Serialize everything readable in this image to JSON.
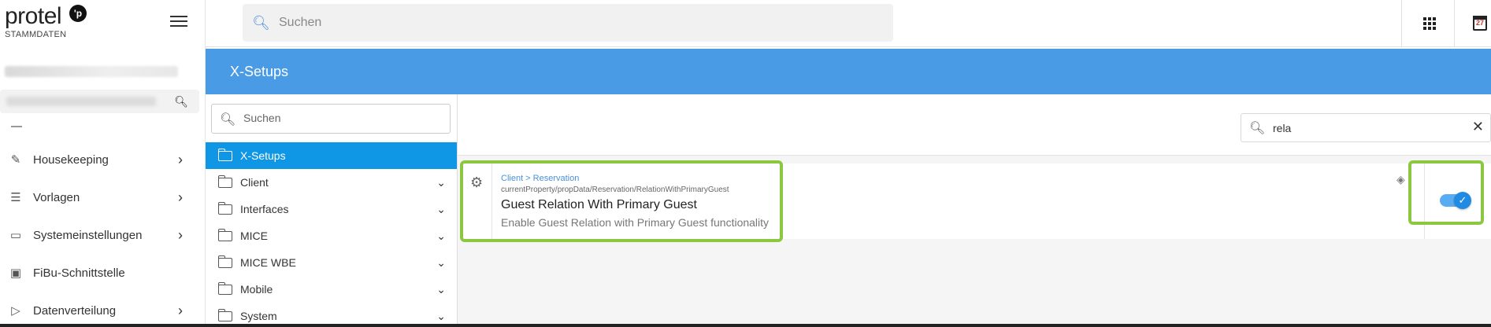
{
  "brand": {
    "name": "protel",
    "badge": "'p",
    "subtitle": "STAMMDATEN"
  },
  "top_search": {
    "placeholder": "Suchen"
  },
  "banner": {
    "title": "X-Setups"
  },
  "sidebar": {
    "items": [
      {
        "label": "Housekeeping",
        "icon": "brush-icon",
        "chevron": "›"
      },
      {
        "label": "Vorlagen",
        "icon": "document-icon",
        "chevron": "›"
      },
      {
        "label": "Systemeinstellungen",
        "icon": "settings-monitor-icon",
        "chevron": "›"
      },
      {
        "label": "FiBu-Schnittstelle",
        "icon": "money-icon",
        "chevron": ""
      },
      {
        "label": "Datenverteilung",
        "icon": "distribution-icon",
        "chevron": "›"
      }
    ]
  },
  "tree": {
    "search_placeholder": "Suchen",
    "items": [
      {
        "label": "X-Setups",
        "active": true
      },
      {
        "label": "Client"
      },
      {
        "label": "Interfaces"
      },
      {
        "label": "MICE"
      },
      {
        "label": "MICE WBE"
      },
      {
        "label": "Mobile"
      },
      {
        "label": "System"
      }
    ]
  },
  "filter": {
    "value": "rela"
  },
  "setting": {
    "path": "Client > Reservation",
    "key": "currentProperty/propData/Reservation/RelationWithPrimaryGuest",
    "title": "Guest Relation With Primary Guest",
    "description": "Enable Guest Relation with Primary Guest functionality",
    "enabled": true
  },
  "colors": {
    "banner": "#4a9be6",
    "active_tree": "#0f97e5",
    "highlight": "#8bc83f",
    "toggle": "#1f8be3"
  }
}
